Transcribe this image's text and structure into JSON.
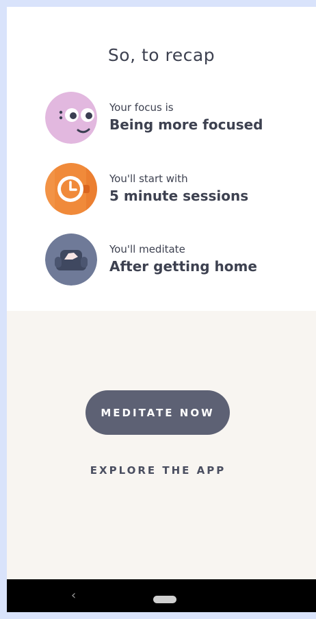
{
  "recap": {
    "title": "So, to recap",
    "items": [
      {
        "label": "Your focus is",
        "value": "Being more focused",
        "icon": "focused-face-icon",
        "color": "#e2b8df"
      },
      {
        "label": "You'll start with",
        "value": "5 minute sessions",
        "icon": "clock-icon",
        "color": "#f08a3a"
      },
      {
        "label": "You'll meditate",
        "value": "After getting home",
        "icon": "armchair-icon",
        "color": "#6f7a98"
      }
    ]
  },
  "actions": {
    "primary": "MEDITATE NOW",
    "secondary": "EXPLORE THE APP"
  },
  "navbar": {
    "back_glyph": "‹"
  },
  "colors": {
    "top_bg": "#ffffff",
    "bottom_bg": "#f8f5f1",
    "button_bg": "#5d6174",
    "text": "#3d4150",
    "frame": "#d9e3fb"
  }
}
